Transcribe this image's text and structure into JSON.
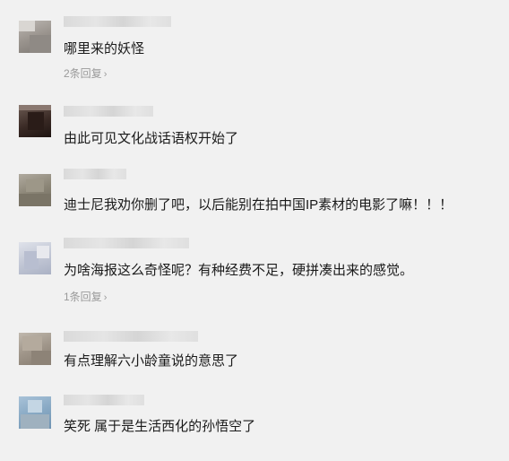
{
  "comments": [
    {
      "text": "哪里来的妖怪",
      "replies": "2条回复",
      "chevron": "›"
    },
    {
      "text": "由此可见文化战话语权开始了"
    },
    {
      "text": "迪士尼我劝你删了吧，以后能别在拍中国IP素材的电影了嘛！！！"
    },
    {
      "text": "为啥海报这么奇怪呢？有种经费不足，硬拼凑出来的感觉。",
      "replies": "1条回复",
      "chevron": "›"
    },
    {
      "text": "有点理解六小龄童说的意思了"
    },
    {
      "text": "笑死 属于是生活西化的孙悟空了"
    }
  ]
}
